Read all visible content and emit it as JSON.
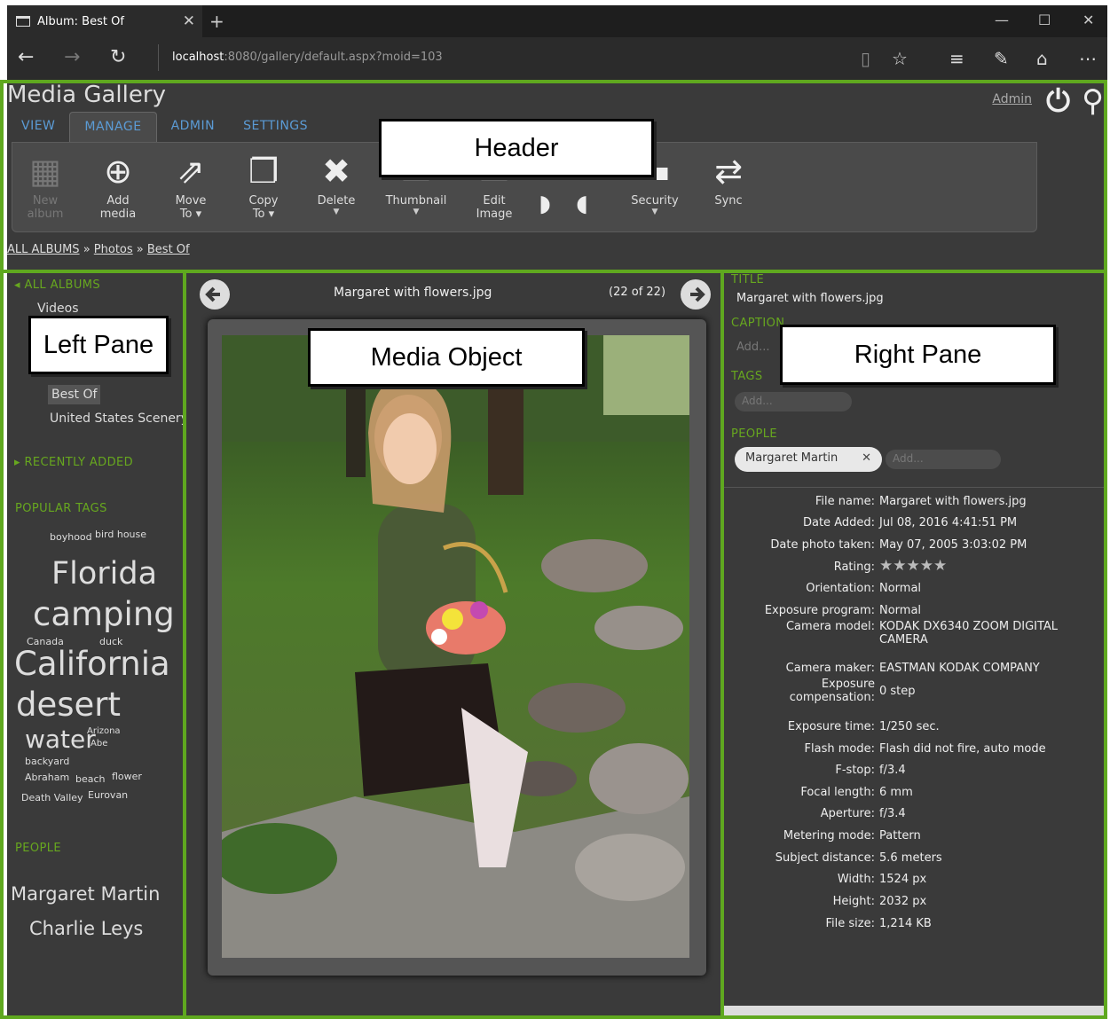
{
  "browser": {
    "tab_title": "Album: Best Of",
    "url_host": "localhost",
    "url_rest": ":8080/gallery/default.aspx?moid=103"
  },
  "gallery": {
    "title": "Media Gallery",
    "admin_link": "Admin",
    "tabs": [
      "VIEW",
      "MANAGE",
      "ADMIN",
      "SETTINGS"
    ],
    "toolbar": [
      {
        "label": "New album",
        "line1": "New",
        "line2": "album",
        "icon": "new-album-icon"
      },
      {
        "label": "Add media",
        "line1": "Add",
        "line2": "media",
        "icon": "add-media-icon"
      },
      {
        "label": "Move To",
        "line1": "Move",
        "line2": "To ▾",
        "icon": "move-icon"
      },
      {
        "label": "Copy To",
        "line1": "Copy",
        "line2": "To ▾",
        "icon": "copy-icon"
      },
      {
        "label": "Delete",
        "line1": "Delete",
        "line2": "",
        "icon": "delete-icon"
      },
      {
        "label": "Thumbnail",
        "line1": "Thumbnail",
        "line2": "",
        "icon": "thumbnail-icon"
      },
      {
        "label": "Edit Image",
        "line1": "Edit",
        "line2": "Image",
        "icon": "edit-image-icon"
      },
      {
        "label": "Security",
        "line1": "Security",
        "line2": "",
        "icon": "security-icon"
      },
      {
        "label": "Sync",
        "line1": "Sync",
        "line2": "",
        "icon": "sync-icon"
      }
    ],
    "breadcrumb": [
      "ALL ALBUMS",
      "Photos",
      "Best Of"
    ]
  },
  "left_pane": {
    "all_albums": "ALL ALBUMS",
    "albums": [
      "Videos",
      "Best Of",
      "United States Scenery"
    ],
    "recently_added": "RECENTLY ADDED",
    "popular_tags_heading": "POPULAR TAGS",
    "tags": [
      "boyhood",
      "bird house",
      "Florida",
      "camping",
      "Canada",
      "duck",
      "California",
      "desert",
      "water",
      "Arizona",
      "Abe",
      "backyard",
      "Abraham",
      "beach",
      "flower",
      "Death Valley",
      "Eurovan"
    ],
    "people_heading": "PEOPLE",
    "people": [
      "Margaret Martin",
      "Charlie Leys"
    ]
  },
  "center_pane": {
    "filename": "Margaret with flowers.jpg",
    "position": "(22 of 22)"
  },
  "right_pane": {
    "title_label": "TITLE",
    "title_value": "Margaret with flowers.jpg",
    "caption_label": "CAPTION",
    "caption_placeholder": "Add...",
    "tags_label": "TAGS",
    "tags_placeholder": "Add...",
    "people_label": "PEOPLE",
    "person_tag": "Margaret Martin",
    "people_placeholder": "Add...",
    "metadata": [
      {
        "k": "File name:",
        "v": "Margaret with flowers.jpg"
      },
      {
        "k": "Date Added:",
        "v": "Jul 08, 2016 4:41:51 PM"
      },
      {
        "k": "Date photo taken:",
        "v": "May 07, 2005 3:03:02 PM"
      },
      {
        "k": "Rating:",
        "v": "★★★★★"
      },
      {
        "k": "Orientation:",
        "v": "Normal"
      },
      {
        "k": "Exposure program:",
        "v": "Normal"
      },
      {
        "k": "Camera model:",
        "v": "KODAK DX6340 ZOOM DIGITAL CAMERA"
      },
      {
        "k": "Camera maker:",
        "v": "EASTMAN KODAK COMPANY"
      },
      {
        "k": "Exposure compensation:",
        "v": "0 step"
      },
      {
        "k": "Exposure time:",
        "v": "1/250 sec."
      },
      {
        "k": "Flash mode:",
        "v": "Flash did not fire, auto mode"
      },
      {
        "k": "F-stop:",
        "v": "f/3.4"
      },
      {
        "k": "Focal length:",
        "v": "6 mm"
      },
      {
        "k": "Aperture:",
        "v": "f/3.4"
      },
      {
        "k": "Metering mode:",
        "v": "Pattern"
      },
      {
        "k": "Subject distance:",
        "v": "5.6 meters"
      },
      {
        "k": "Width:",
        "v": "1524 px"
      },
      {
        "k": "Height:",
        "v": "2032 px"
      },
      {
        "k": "File size:",
        "v": "1,214 KB"
      }
    ]
  },
  "callouts": [
    "Header",
    "Left Pane",
    "Media Object",
    "Right Pane"
  ],
  "colors": {
    "accent_green": "#5fa81f",
    "link_blue": "#5b9bd5"
  }
}
